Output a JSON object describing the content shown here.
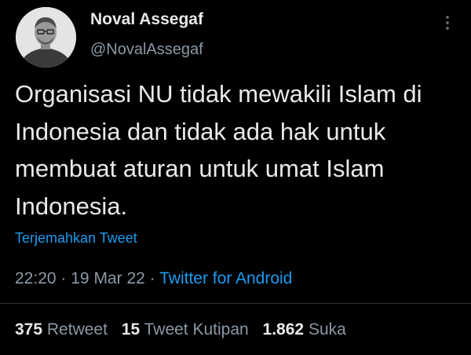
{
  "tweet": {
    "display_name": "Noval Assegaf",
    "handle": "@NovalAssegaf",
    "text": "Organisasi NU tidak mewakili Islam di Indonesia dan tidak ada hak untuk membuat aturan untuk umat Islam Indonesia.",
    "translate_label": "Terjemahkan Tweet",
    "time": "22:20",
    "separator": "·",
    "date": "19 Mar 22",
    "source": "Twitter for Android",
    "more_icon": "more-vertical-icon"
  },
  "stats": {
    "retweets": {
      "count": "375",
      "label": "Retweet"
    },
    "quotes": {
      "count": "15",
      "label": "Tweet Kutipan"
    },
    "likes": {
      "count": "1.862",
      "label": "Suka"
    }
  },
  "colors": {
    "background": "#000000",
    "text": "#e7e9ea",
    "muted": "#8b98a5",
    "link": "#1d9bf0",
    "divider": "#2f3336"
  }
}
